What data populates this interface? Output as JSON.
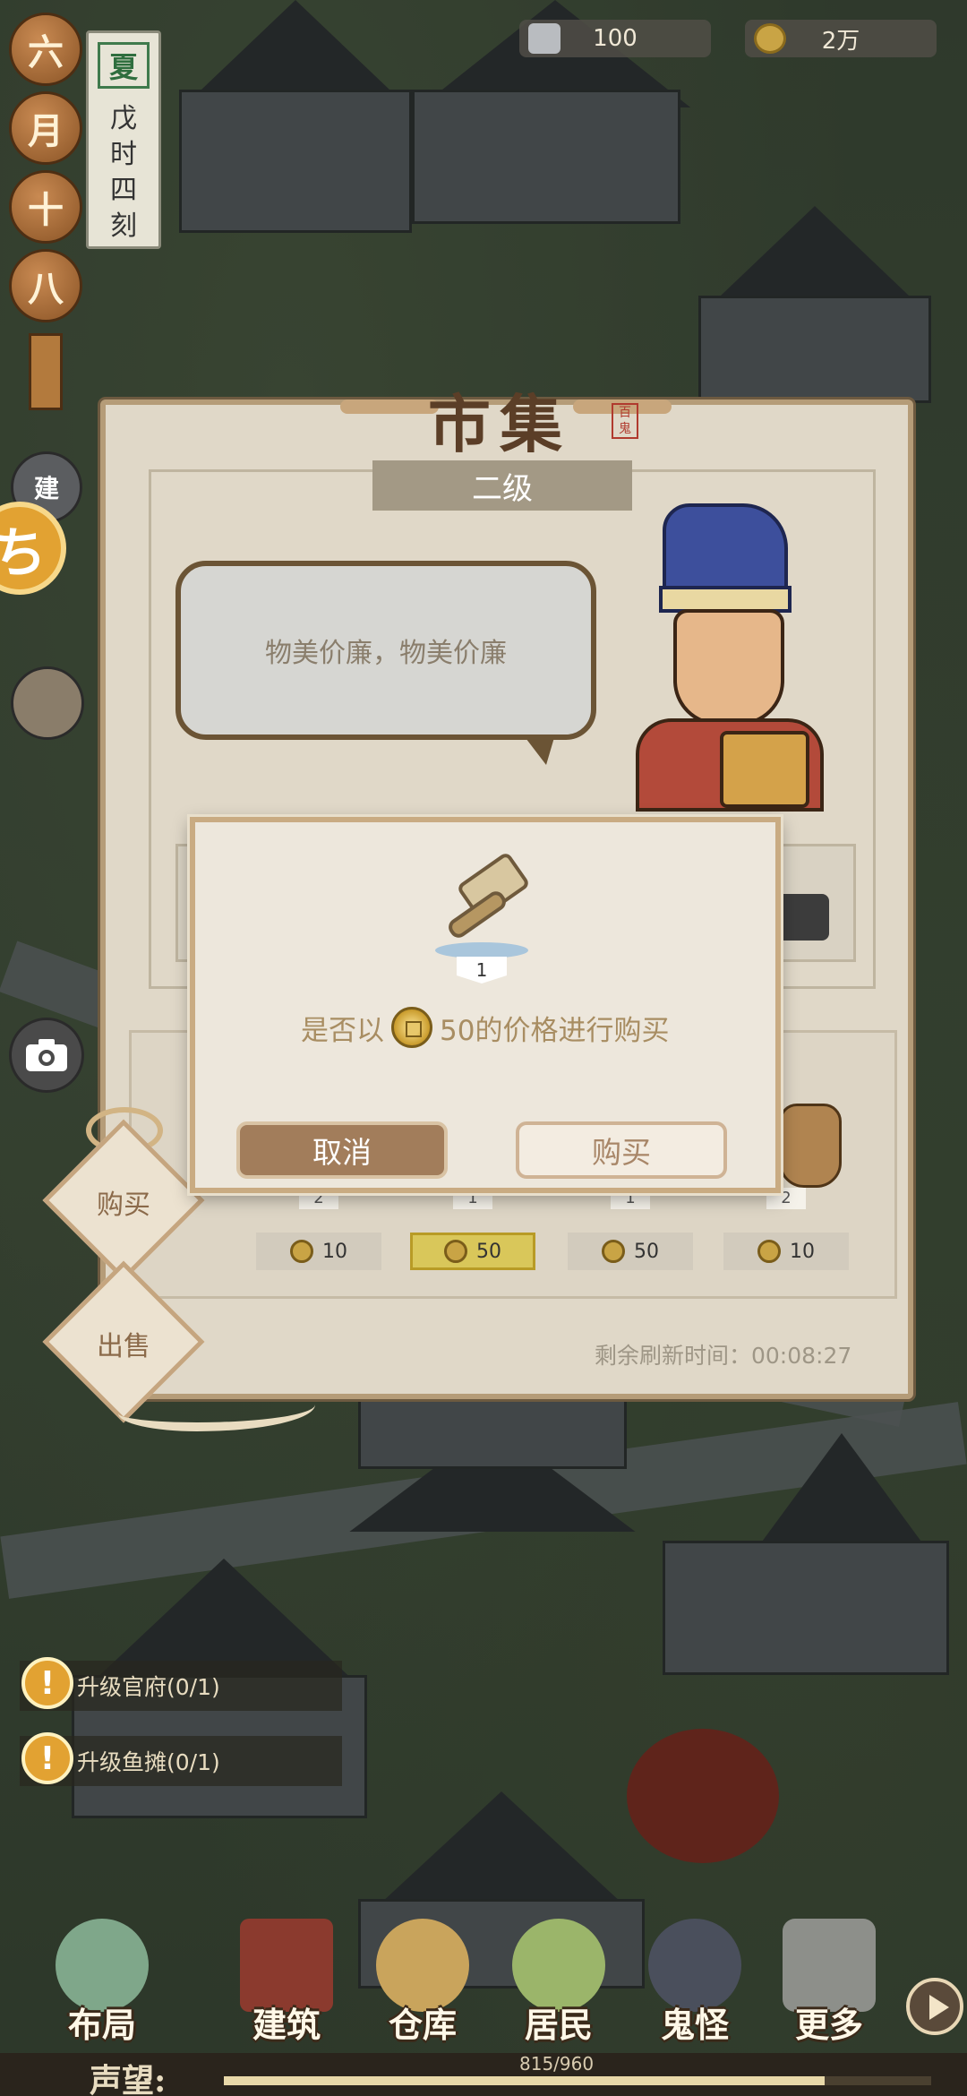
{
  "top_bar": {
    "silver": "100",
    "coins": "2万"
  },
  "calendar": {
    "beads": [
      "六",
      "月",
      "十",
      "八"
    ],
    "season": "夏",
    "time": [
      "戊",
      "时",
      "四",
      "刻"
    ]
  },
  "side": {
    "build_short": "建",
    "gold_icon": "ち"
  },
  "market": {
    "title": "市集",
    "seal": "百鬼",
    "level": "二级",
    "speech": "物美价廉，物美价廉",
    "tabs": {
      "buy": "购买",
      "sell": "出售"
    },
    "items": [
      {
        "qty": "2",
        "price": "10",
        "selected": false
      },
      {
        "qty": "1",
        "price": "50",
        "selected": true
      },
      {
        "qty": "1",
        "price": "50",
        "selected": false
      },
      {
        "qty": "2",
        "price": "10",
        "selected": false
      }
    ],
    "refresh": "剩余刷新时间：00:08:27"
  },
  "dialog": {
    "item_icon": "hammer-icon",
    "qty": "1",
    "msg_prefix": "是否以",
    "msg_suffix": "50的价格进行购买",
    "cancel": "取消",
    "buy": "购买"
  },
  "quests": [
    {
      "label": "升级官府(0/1)"
    },
    {
      "label": "升级鱼摊(0/1)"
    }
  ],
  "nav": [
    {
      "label": "布局"
    },
    {
      "label": "建筑"
    },
    {
      "label": "仓库"
    },
    {
      "label": "居民"
    },
    {
      "label": "鬼怪"
    },
    {
      "label": "更多"
    }
  ],
  "reputation": {
    "label": "声望:",
    "value": "815/960",
    "fraction": 0.849
  },
  "colors": {
    "panel": "#e0d8c8",
    "accent_gold": "#e2a232",
    "cancel_button": "#a27d5b"
  }
}
